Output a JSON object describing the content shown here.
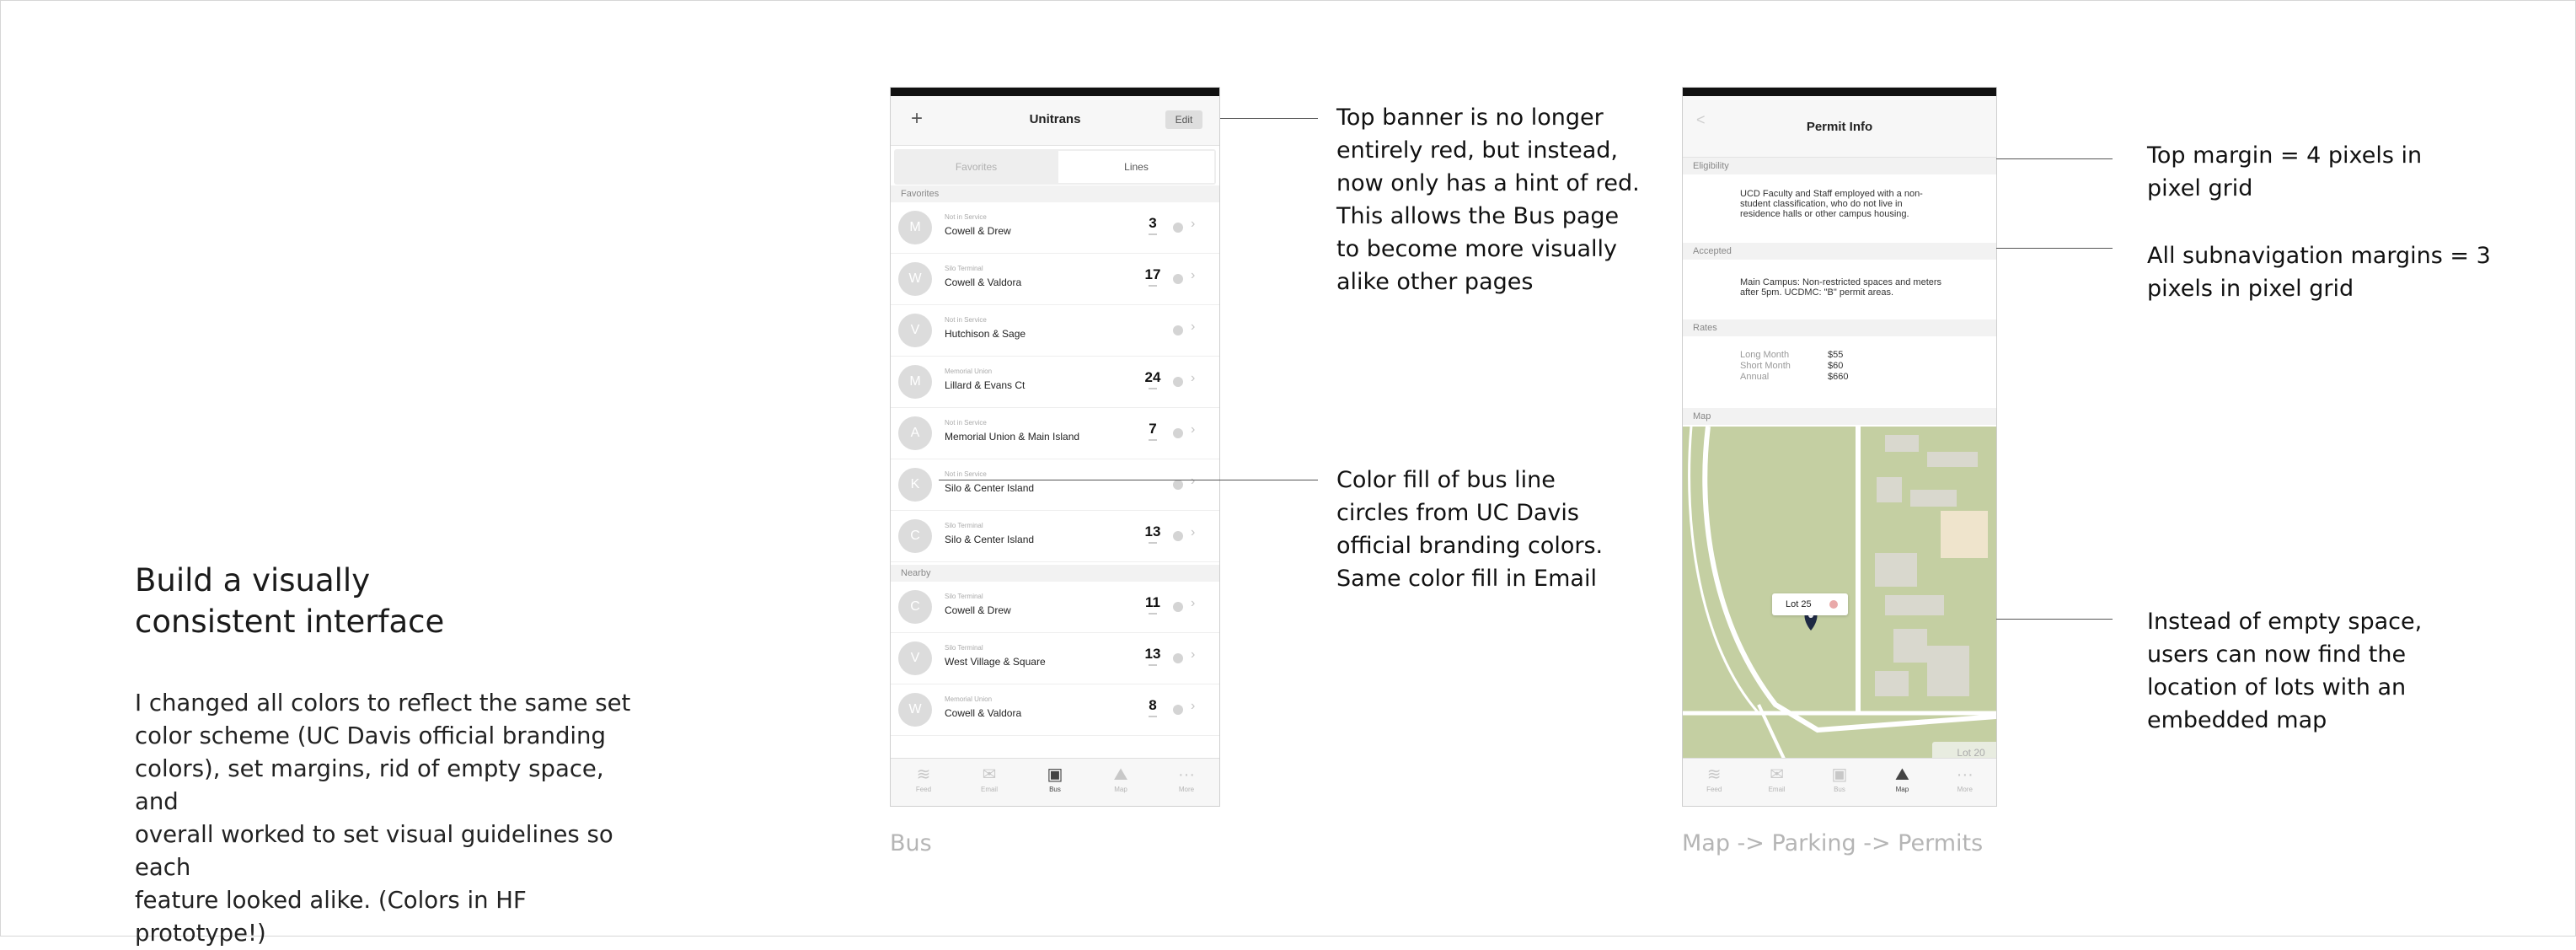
{
  "left": {
    "heading_line1": "Build a visually",
    "heading_line2": "consistent interface",
    "body_lines": [
      "I changed all colors to reflect the same set",
      "color scheme (UC Davis official branding",
      "colors), set margins, rid of empty space, and",
      "overall worked to set visual guidelines so each",
      "feature looked alike. (Colors in HF prototype!)"
    ]
  },
  "captions": {
    "bus": "Bus",
    "map": "Map -> Parking -> Permits"
  },
  "annotations": {
    "top_banner": [
      "Top banner is no longer",
      "entirely red, but instead,",
      "now only has a hint of red.",
      "This allows the Bus page",
      "to become more visually",
      "alike other pages"
    ],
    "color_fill": [
      "Color fill of bus line",
      "circles from UC Davis",
      "official branding colors.",
      "Same color fill in Email"
    ],
    "top_margin": [
      "Top margin = 4 pixels in",
      "pixel grid"
    ],
    "subnav_margins": [
      "All subnavigation margins = 3",
      "pixels in pixel grid"
    ],
    "empty_space": [
      "Instead of empty space,",
      "users can now find the",
      "location of lots with an",
      "embedded map"
    ]
  },
  "bus_screen": {
    "plus_icon": "+",
    "title": "Unitrans",
    "edit": "Edit",
    "seg_favorites": "Favorites",
    "seg_lines": "Lines",
    "section_favorites": "Favorites",
    "section_nearby": "Nearby",
    "favorites": [
      {
        "letter": "M",
        "status": "Not in Service",
        "stop": "Cowell & Drew",
        "mins": "3"
      },
      {
        "letter": "W",
        "status": "Silo Terminal",
        "stop": "Cowell & Valdora",
        "mins": "17"
      },
      {
        "letter": "V",
        "status": "Not in Service",
        "stop": "Hutchison & Sage",
        "mins": ""
      },
      {
        "letter": "M",
        "status": "Memorial Union",
        "stop": "Lillard & Evans Ct",
        "mins": "24"
      },
      {
        "letter": "A",
        "status": "Not in Service",
        "stop": "Memorial Union & Main Island",
        "mins": "7"
      },
      {
        "letter": "K",
        "status": "Not in Service",
        "stop": "Silo & Center Island",
        "mins": ""
      },
      {
        "letter": "C",
        "status": "Silo Terminal",
        "stop": "Silo & Center Island",
        "mins": "13"
      }
    ],
    "nearby": [
      {
        "letter": "C",
        "status": "Silo Terminal",
        "stop": "Cowell & Drew",
        "mins": "11"
      },
      {
        "letter": "V",
        "status": "Silo Terminal",
        "stop": "West Village & Square",
        "mins": "13"
      },
      {
        "letter": "W",
        "status": "Memorial Union",
        "stop": "Cowell & Valdora",
        "mins": "8"
      }
    ],
    "tabs": [
      {
        "label": "Feed",
        "icon": "feed-icon",
        "glyph": "≋"
      },
      {
        "label": "Email",
        "icon": "email-icon",
        "glyph": "✉"
      },
      {
        "label": "Bus",
        "icon": "bus-icon",
        "glyph": "▣"
      },
      {
        "label": "Map",
        "icon": "map-icon",
        "glyph": "⛰"
      },
      {
        "label": "More",
        "icon": "more-icon",
        "glyph": "···"
      }
    ],
    "active_tab": "Bus"
  },
  "permit_screen": {
    "back_icon": "<",
    "title": "Permit Info",
    "section_eligibility": "Eligibility",
    "eligibility_text": "UCD Faculty and Staff employed with a non-student classification, who do not live in residence halls or other campus housing.",
    "section_accepted": "Accepted",
    "accepted_text": "Main Campus: Non-restricted spaces and meters after 5pm. UCDMC: \"B\" permit areas.",
    "section_rates": "Rates",
    "rates": [
      {
        "label": "Long Month",
        "value": "$55"
      },
      {
        "label": "Short Month",
        "value": "$60"
      },
      {
        "label": "Annual",
        "value": "$660"
      }
    ],
    "section_map": "Map",
    "lot_callout": "Lot 25",
    "lot_other": "Lot 20",
    "tabs": [
      {
        "label": "Feed",
        "icon": "feed-icon",
        "glyph": "≋"
      },
      {
        "label": "Email",
        "icon": "email-icon",
        "glyph": "✉"
      },
      {
        "label": "Bus",
        "icon": "bus-icon",
        "glyph": "▣"
      },
      {
        "label": "Map",
        "icon": "map-icon",
        "glyph": "⛰"
      },
      {
        "label": "More",
        "icon": "more-icon",
        "glyph": "···"
      }
    ],
    "active_tab": "Map"
  }
}
